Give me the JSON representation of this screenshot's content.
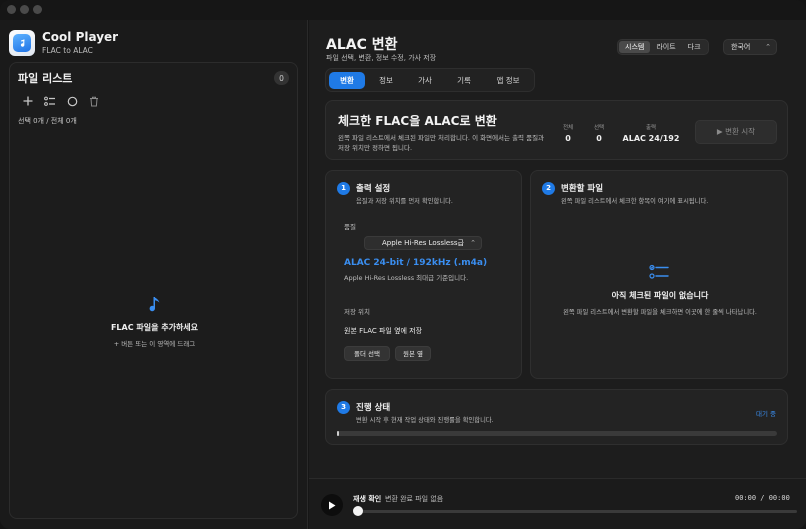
{
  "app": {
    "name": "Cool Player",
    "subtitle": "FLAC to ALAC"
  },
  "sidebar": {
    "title": "파일 리스트",
    "count": "0",
    "selection_text": "선택 0개 / 전체 0개",
    "toolbar": [
      {
        "icon": "plus-icon",
        "label": ""
      },
      {
        "icon": "checklist-icon",
        "label": ""
      },
      {
        "icon": "circle-icon",
        "label": ""
      },
      {
        "icon": "trash-icon",
        "label": ""
      }
    ],
    "empty": {
      "icon": "music-note-icon",
      "title": "FLAC 파일을 추가하세요",
      "subtitle": "+ 버튼 또는 이 영역에 드래그"
    }
  },
  "header": {
    "title": "ALAC 변환",
    "subtitle": "파일 선택, 변환, 정보 수정, 가사 저장",
    "theme_options": [
      {
        "label": "시스템",
        "active": true
      },
      {
        "label": "라이트",
        "active": false
      },
      {
        "label": "다크",
        "active": false
      }
    ],
    "language": "한국어"
  },
  "tabs": [
    {
      "label": "변환",
      "active": true
    },
    {
      "label": "정보",
      "active": false
    },
    {
      "label": "가사",
      "active": false
    },
    {
      "label": "기록",
      "active": false
    },
    {
      "label": "앱 정보",
      "active": false
    }
  ],
  "hero": {
    "title": "체크한 FLAC을 ALAC로 변환",
    "description": "왼쪽 파일 리스트에서 체크된 파일만 처리합니다. 이 화면에서는 출력 품질과 저장 위치만 정하면 됩니다.",
    "stats": [
      {
        "label": "전체",
        "value": "0"
      },
      {
        "label": "선택",
        "value": "0"
      },
      {
        "label": "출력",
        "value": "ALAC 24/192"
      }
    ],
    "start_button": "▶ 변환 시작"
  },
  "output_settings": {
    "step": "1",
    "title": "출력 설정",
    "subtitle": "음질과 저장 위치를 먼저 확인합니다.",
    "quality_label": "품질",
    "quality_value": "Apple Hi-Res Lossless급",
    "format": "ALAC 24-bit / 192kHz (.m4a)",
    "format_note": "Apple Hi-Res Lossless 최대급 기준입니다.",
    "location_label": "저장 위치",
    "location_value": "원본 FLAC 파일 옆에 저장",
    "choose_folder": "폴더 선택",
    "original_location": "원본 옆"
  },
  "files_to_convert": {
    "step": "2",
    "title": "변환할 파일",
    "subtitle": "왼쪽 파일 리스트에서 체크한 항목이 여기에 표시됩니다.",
    "empty_icon": "checklist-icon",
    "empty_title": "아직 체크된 파일이 없습니다",
    "empty_subtitle": "왼쪽 파일 리스트에서 변환할 파일을 체크하면 이곳에 한 줄씩 나타납니다."
  },
  "progress": {
    "step": "3",
    "title": "진행 상태",
    "subtitle": "변환 시작 후 현재 작업 상태와 진행률을 확인합니다.",
    "status": "대기 중",
    "fraction": 0.005
  },
  "player": {
    "label": "재생 확인",
    "status": "변환 완료 파일 없음",
    "time": "00:00 / 00:00",
    "seek_fraction": 0
  },
  "colors": {
    "accent": "#1f7ae6",
    "link": "#3a8ef0"
  }
}
